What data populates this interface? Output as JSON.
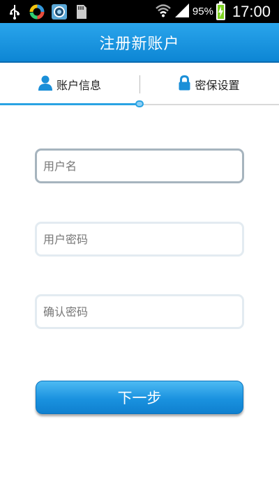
{
  "status_bar": {
    "icons": [
      "usb-icon",
      "app-ring-icon",
      "camera-app-icon",
      "sd-card-icon",
      "wifi-icon",
      "signal-icon",
      "battery-charging-icon"
    ],
    "battery_percent": "95%",
    "time": "17:00",
    "battery_color": "#7ed321"
  },
  "header": {
    "title": "注册新账户",
    "color": "#1593dd"
  },
  "tabs": [
    {
      "label": "账户信息",
      "icon": "user-icon",
      "active": true
    },
    {
      "label": "密保设置",
      "icon": "lock-icon",
      "active": false
    }
  ],
  "progress": {
    "step": 1,
    "total": 2,
    "fraction": 0.5,
    "color": "#29a3e3"
  },
  "form": {
    "username": {
      "placeholder": "用户名",
      "value": ""
    },
    "password": {
      "placeholder": "用户密码",
      "value": ""
    },
    "confirm": {
      "placeholder": "确认密码",
      "value": ""
    }
  },
  "next_button": {
    "label": "下一步"
  }
}
